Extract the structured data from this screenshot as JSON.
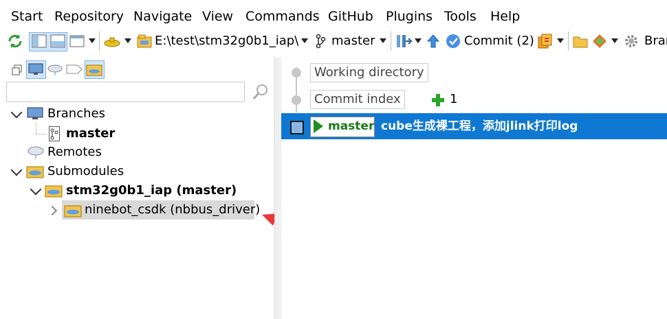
{
  "menu": [
    "Start",
    "Repository",
    "Navigate",
    "View",
    "Commands",
    "GitHub",
    "Plugins",
    "Tools",
    "Help"
  ],
  "toolbar": {
    "path": "E:\\test\\stm32g0b1_iap\\",
    "branch": "master",
    "commit_label": "Commit (2)",
    "truncated": "Brar"
  },
  "search": {
    "placeholder": ""
  },
  "tree": {
    "branches": "Branches",
    "master": "master",
    "remotes": "Remotes",
    "submodules": "Submodules",
    "sub1": "stm32g0b1_iap (master)",
    "sub2": "ninebot_csdk (nbbus_driver)"
  },
  "graph": {
    "working": "Working directory",
    "index": "Commit index",
    "index_count": "1",
    "branch_badge": "master",
    "commit_msg": "cube生成裸工程，添加jlink打印log"
  },
  "colors": {
    "selection": "#0f78d2",
    "annotation_arrow": "#e8393c",
    "add_green": "#2aa52a"
  }
}
